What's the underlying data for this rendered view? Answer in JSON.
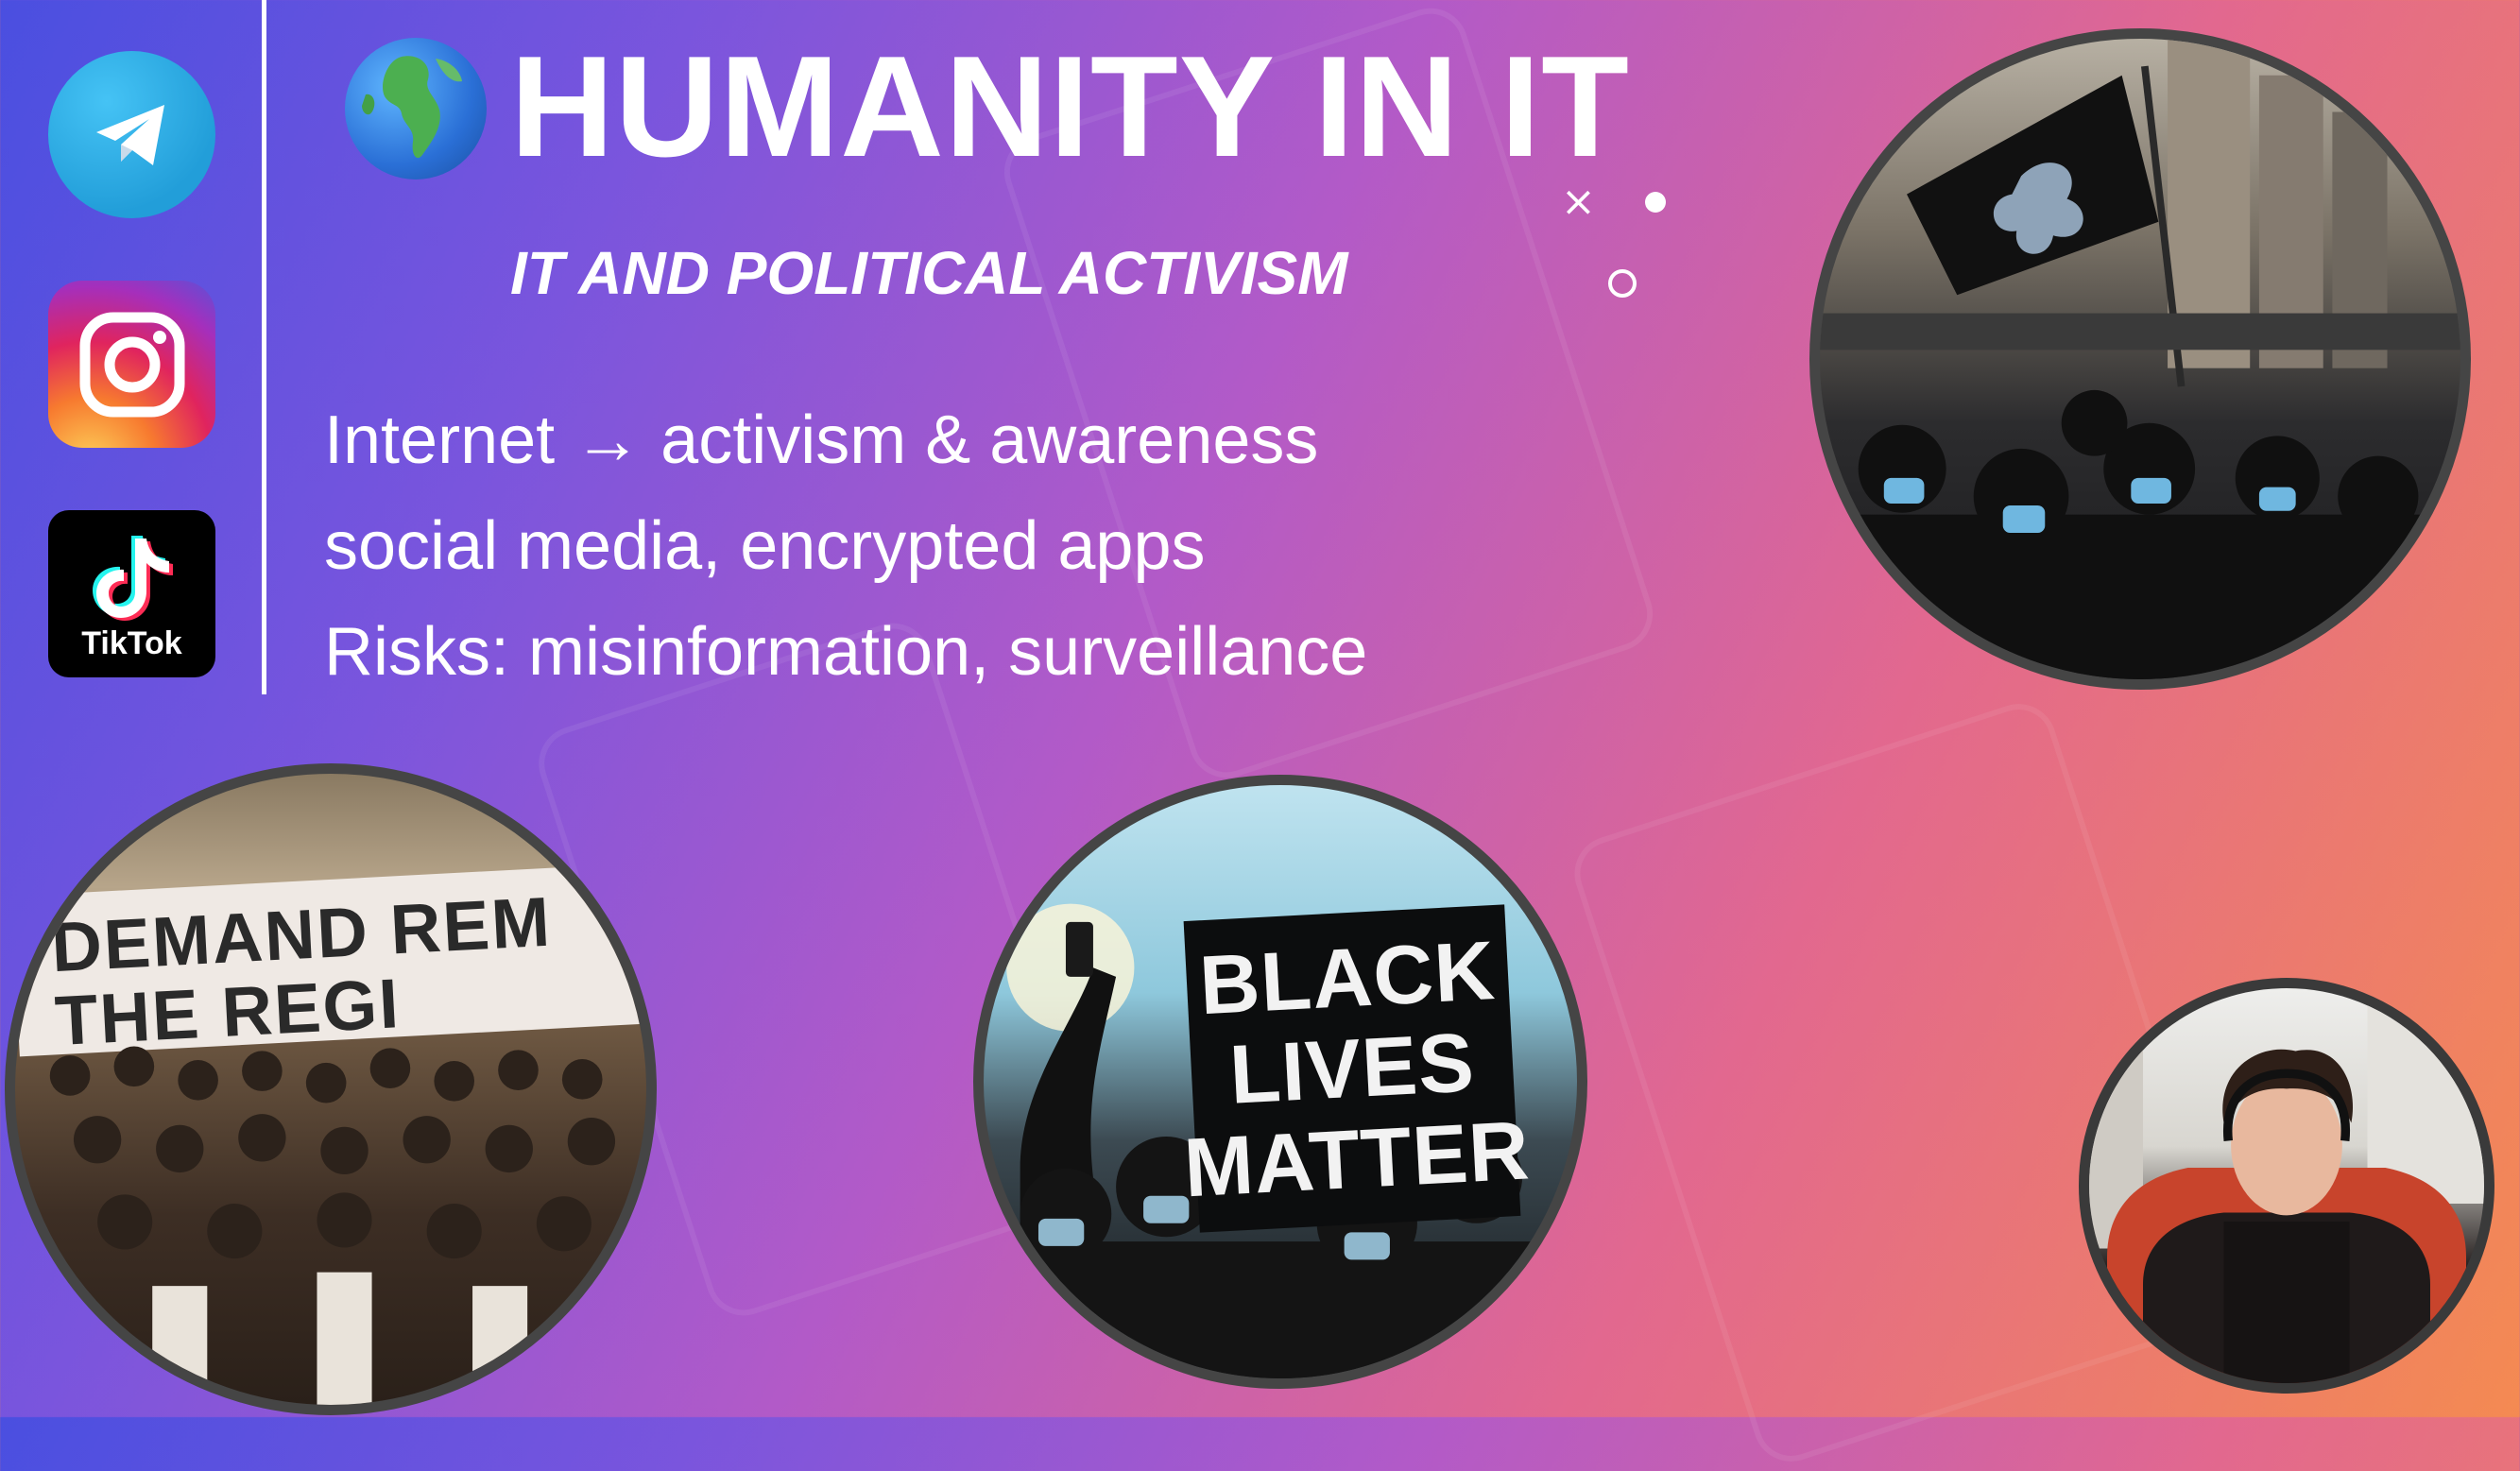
{
  "header": {
    "title": "HUMANITY IN IT",
    "subtitle": "IT AND POLITICAL ACTIVISM"
  },
  "bullets": [
    "Internet → activism & awareness",
    "social media, encrypted apps",
    "Risks: misinformation, surveillance"
  ],
  "apps": [
    {
      "name": "telegram-icon"
    },
    {
      "name": "instagram-icon"
    },
    {
      "name": "tiktok-icon",
      "label": "TikTok"
    }
  ],
  "photos": {
    "protest_banner": {
      "line1": "DEMAND REM",
      "line2": "THE REGI"
    },
    "blm_sign": {
      "line1": "BLACK",
      "line2": "LIVES",
      "line3": "MATTER"
    }
  },
  "decorations": {
    "cross_glyph": "×"
  },
  "colors": {
    "gradient_start": "#4a4fe0",
    "gradient_mid": "#b25ac8",
    "gradient_end": "#f48a52",
    "text": "#ffffff",
    "photo_border": "#454545"
  }
}
